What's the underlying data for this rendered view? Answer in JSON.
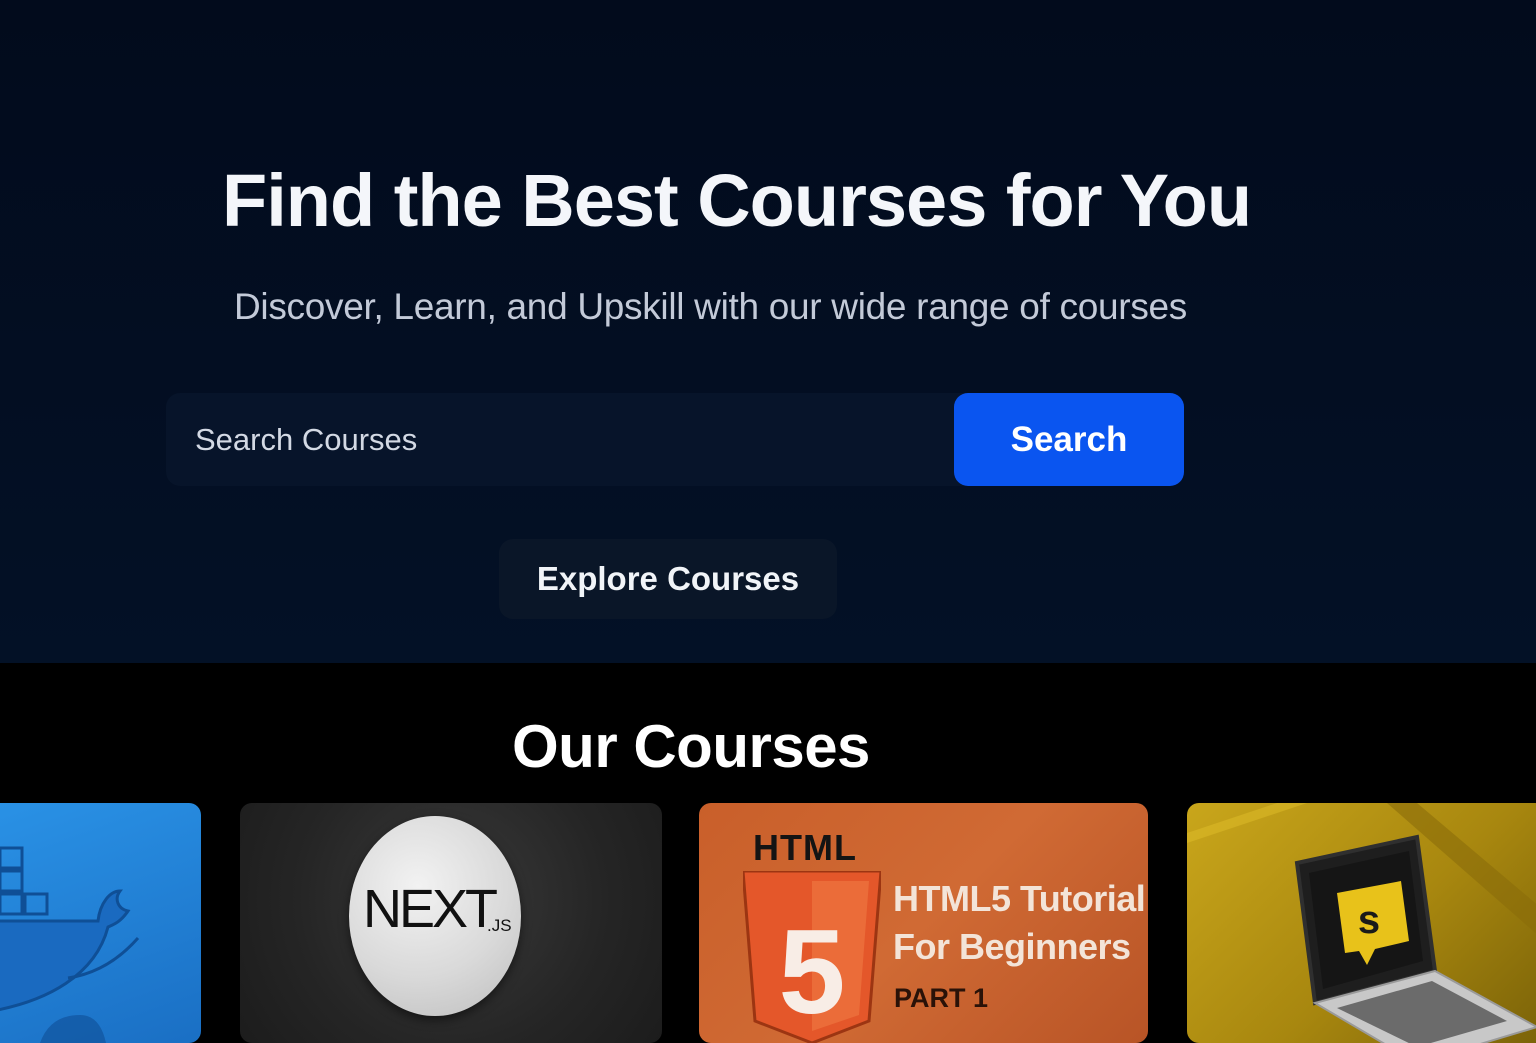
{
  "hero": {
    "title": "Find the Best Courses for You",
    "subtitle": "Discover, Learn, and Upskill with our wide range of courses",
    "search": {
      "placeholder": "Search Courses",
      "button_label": "Search"
    },
    "explore_label": "Explore Courses"
  },
  "courses": {
    "title": "Our Courses",
    "cards": [
      {
        "icon": "docker-whale-icon",
        "color": "#2a92e6"
      },
      {
        "icon": "nextjs-logo-icon",
        "logo_text": "NEXT",
        "logo_sub": ".JS",
        "color": "#2a2a2a"
      },
      {
        "icon": "html5-shield-icon",
        "label": "HTML",
        "title_line1": "HTML5 Tutorial",
        "title_line2": "For Beginners",
        "part": "PART 1",
        "shield_number": "5",
        "color": "#c95f2a"
      },
      {
        "icon": "laptop-code-icon",
        "color": "#c9a61b"
      }
    ]
  },
  "colors": {
    "background": "#020b1c",
    "accent": "#0a55f0",
    "text": "#f4f6fa"
  }
}
